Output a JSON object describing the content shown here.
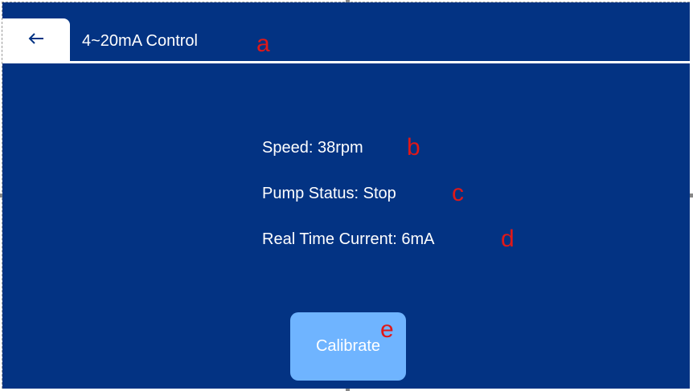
{
  "header": {
    "back_icon": "arrow-left-icon",
    "title": "4~20mA Control"
  },
  "status": {
    "speed": "Speed: 38rpm",
    "pump_status": "Pump Status: Stop",
    "current": "Real Time Current: 6mA"
  },
  "actions": {
    "calibrate_label": "Calibrate"
  },
  "annotations": {
    "a": "a",
    "b": "b",
    "c": "c",
    "d": "d",
    "e": "e"
  },
  "colors": {
    "background": "#033383",
    "button": "#6fb4ff",
    "annotation": "#e01818",
    "text": "#ffffff"
  }
}
